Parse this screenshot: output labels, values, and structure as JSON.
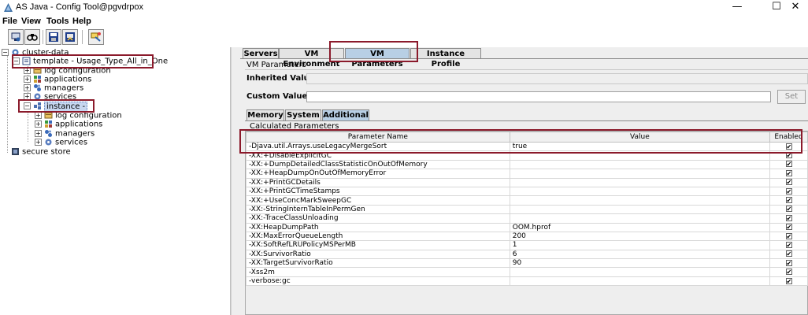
{
  "window": {
    "title": "AS Java - Config Tool@pgvdrpox",
    "minimize": "—",
    "maximize": "☐",
    "close": "✕"
  },
  "menu": [
    "File",
    "View",
    "Tools",
    "Help"
  ],
  "toolbar": {
    "icons": [
      "connect-icon",
      "search-icon",
      "save-icon",
      "export-icon",
      "switch-mode-icon"
    ]
  },
  "tree": {
    "root": "cluster-data",
    "template": "template - Usage_Type_All_in_One",
    "template_children": [
      "log configuration",
      "applications",
      "managers",
      "services"
    ],
    "instance": "instance -",
    "instance_children": [
      "log configuration",
      "applications",
      "managers",
      "services"
    ],
    "secure_store": "secure store"
  },
  "tabs": [
    "Servers",
    "VM Environment",
    "VM Parameters",
    "Instance Profile"
  ],
  "active_tab": "VM Parameters",
  "vm_parameters": {
    "section_title": "VM Parameters",
    "inherited_label": "Inherited Value",
    "custom_label": "Custom Value",
    "custom_value": "",
    "set_button": "Set"
  },
  "subtabs": [
    "Memory",
    "System",
    "Additional"
  ],
  "active_subtab": "Additional",
  "calculated": {
    "title": "Calculated Parameters",
    "columns": [
      "Parameter Name",
      "Value",
      "Enabled"
    ],
    "rows": [
      {
        "name": "-Djava.util.Arrays.useLegacyMergeSort",
        "value": "true",
        "enabled": true
      },
      {
        "name": "-XX:+DisableExplicitGC",
        "value": "",
        "enabled": true
      },
      {
        "name": "-XX:+DumpDetailedClassStatisticOnOutOfMemory",
        "value": "",
        "enabled": true
      },
      {
        "name": "-XX:+HeapDumpOnOutOfMemoryError",
        "value": "",
        "enabled": true
      },
      {
        "name": "-XX:+PrintGCDetails",
        "value": "",
        "enabled": true
      },
      {
        "name": "-XX:+PrintGCTimeStamps",
        "value": "",
        "enabled": true
      },
      {
        "name": "-XX:+UseConcMarkSweepGC",
        "value": "",
        "enabled": true
      },
      {
        "name": "-XX:-StringInternTableInPermGen",
        "value": "",
        "enabled": true
      },
      {
        "name": "-XX:-TraceClassUnloading",
        "value": "",
        "enabled": true
      },
      {
        "name": "-XX:HeapDumpPath",
        "value": "OOM.hprof",
        "enabled": true
      },
      {
        "name": "-XX:MaxErrorQueueLength",
        "value": "200",
        "enabled": true
      },
      {
        "name": "-XX:SoftRefLRUPolicyMSPerMB",
        "value": "1",
        "enabled": true
      },
      {
        "name": "-XX:SurvivorRatio",
        "value": "6",
        "enabled": true
      },
      {
        "name": "-XX:TargetSurvivorRatio",
        "value": "90",
        "enabled": true
      },
      {
        "name": "-Xss2m",
        "value": "",
        "enabled": true
      },
      {
        "name": "-verbose:gc",
        "value": "",
        "enabled": true
      }
    ]
  },
  "colors": {
    "highlight_box": "#8b1a2b",
    "active_tab": "#b8cfe5",
    "panel_bg": "#eeeeee"
  }
}
